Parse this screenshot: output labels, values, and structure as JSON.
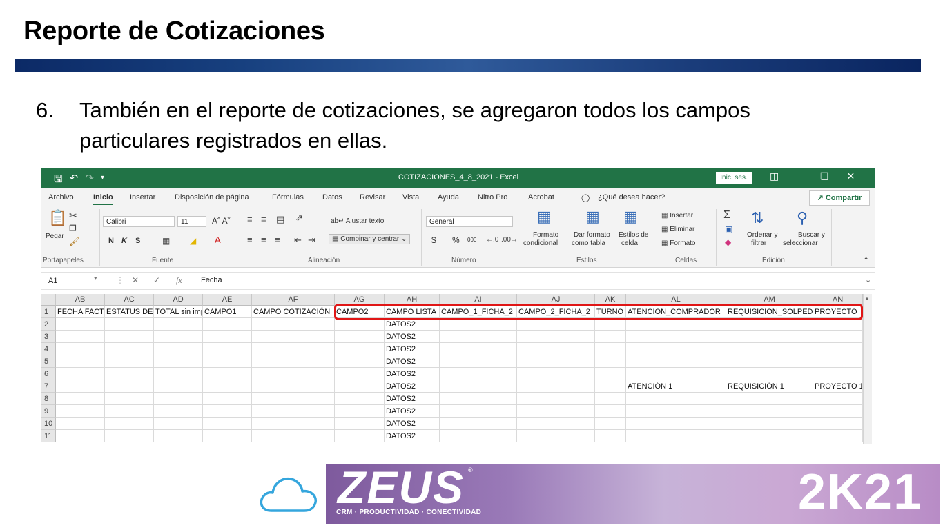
{
  "slide": {
    "title": "Reporte de Cotizaciones",
    "bullet_number": "6.",
    "bullet_text": "También en el reporte de cotizaciones, se agregaron todos los campos particulares registrados en ellas."
  },
  "excel": {
    "window_title": "COTIZACIONES_4_8_2021  -  Excel",
    "login_button": "Inic. ses.",
    "tabs": [
      "Archivo",
      "Inicio",
      "Insertar",
      "Disposición de página",
      "Fórmulas",
      "Datos",
      "Revisar",
      "Vista",
      "Ayuda",
      "Nitro Pro",
      "Acrobat"
    ],
    "active_tab": "Inicio",
    "tell_me": "¿Qué desea hacer?",
    "share": "Compartir",
    "ribbon": {
      "clipboard": {
        "paste": "Pegar",
        "label": "Portapapeles"
      },
      "font": {
        "name": "Calibri",
        "size": "11",
        "bold": "N",
        "italic": "K",
        "underline": "S",
        "label": "Fuente"
      },
      "alignment": {
        "wrap": "Ajustar texto",
        "merge": "Combinar y centrar",
        "label": "Alineación"
      },
      "number": {
        "format": "General",
        "currency": "$",
        "percent": "%",
        "thousands": "000",
        "label": "Número"
      },
      "styles": {
        "conditional_1": "Formato",
        "conditional_2": "condicional",
        "table_1": "Dar formato",
        "table_2": "como tabla",
        "cell_1": "Estilos de",
        "cell_2": "celda",
        "label": "Estilos"
      },
      "cells": {
        "insert": "Insertar",
        "delete": "Eliminar",
        "format": "Formato",
        "label": "Celdas"
      },
      "editing": {
        "sort_1": "Ordenar y",
        "sort_2": "filtrar",
        "find_1": "Buscar y",
        "find_2": "seleccionar",
        "label": "Edición"
      }
    },
    "name_box": "A1",
    "formula_value": "Fecha",
    "columns": [
      "AB",
      "AC",
      "AD",
      "AE",
      "AF",
      "AG",
      "AH",
      "AI",
      "AJ",
      "AK",
      "AL",
      "AM",
      "AN"
    ],
    "rows": [
      [
        "FECHA FACTURA",
        "ESTATUS DE FACTURA",
        "TOTAL sin impuestos",
        "CAMPO1",
        "CAMPO COTIZACIÓN",
        "CAMPO2",
        "CAMPO LISTA",
        "CAMPO_1_FICHA_2",
        "CAMPO_2_FICHA_2",
        "TURNO",
        "ATENCION_COMPRADOR",
        "REQUISICION_SOLPED",
        "PROYECTO"
      ],
      [
        "",
        "",
        "",
        "",
        "",
        "",
        "DATOS2",
        "",
        "",
        "",
        "",
        "",
        ""
      ],
      [
        "",
        "",
        "",
        "",
        "",
        "",
        "DATOS2",
        "",
        "",
        "",
        "",
        "",
        ""
      ],
      [
        "",
        "",
        "",
        "",
        "",
        "",
        "DATOS2",
        "",
        "",
        "",
        "",
        "",
        ""
      ],
      [
        "",
        "",
        "",
        "",
        "",
        "",
        "DATOS2",
        "",
        "",
        "",
        "",
        "",
        ""
      ],
      [
        "",
        "",
        "",
        "",
        "",
        "",
        "DATOS2",
        "",
        "",
        "",
        "",
        "",
        ""
      ],
      [
        "",
        "",
        "",
        "",
        "",
        "",
        "DATOS2",
        "",
        "",
        "",
        "ATENCIÓN 1",
        "REQUISICIÓN 1",
        "PROYECTO 1"
      ],
      [
        "",
        "",
        "",
        "",
        "",
        "",
        "DATOS2",
        "",
        "",
        "",
        "",
        "",
        ""
      ],
      [
        "",
        "",
        "",
        "",
        "",
        "",
        "DATOS2",
        "",
        "",
        "",
        "",
        "",
        ""
      ],
      [
        "",
        "",
        "",
        "",
        "",
        "",
        "DATOS2",
        "",
        "",
        "",
        "",
        "",
        ""
      ],
      [
        "",
        "",
        "",
        "",
        "",
        "",
        "DATOS2",
        "",
        "",
        "",
        "",
        "",
        ""
      ]
    ],
    "colors": {
      "excel_green": "#217346",
      "highlight": "#e01616"
    }
  },
  "footer": {
    "brand": "ZEUS",
    "tagline": "CRM · PRODUCTIVIDAD · CONECTIVIDAD",
    "year": "2K21"
  }
}
